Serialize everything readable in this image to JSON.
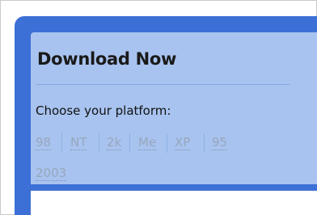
{
  "download": {
    "title": "Download Now",
    "prompt": "Choose your platform:",
    "platforms": [
      "98",
      "NT",
      "2k",
      "Me",
      "XP",
      "95",
      "2003"
    ]
  }
}
